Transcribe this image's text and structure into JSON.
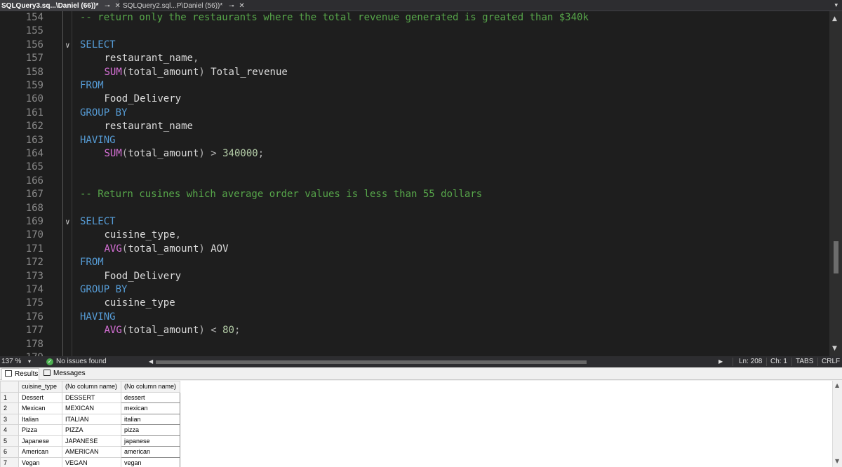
{
  "tabs": [
    {
      "label": "SQLQuery3.sq...\\Daniel (66))*",
      "pin": "⊸",
      "close": "✕",
      "active": true
    },
    {
      "label": "SQLQuery2.sql...P\\Daniel (56))*",
      "pin": "⊸",
      "close": "✕",
      "active": false
    }
  ],
  "tab_overflow_icon": "▾",
  "editor": {
    "lines": [
      {
        "n": "154",
        "fold": "",
        "indent": 0,
        "tokens": [
          [
            "cm",
            "-- return only the restaurants where the total revenue generated is greated than $340k"
          ]
        ]
      },
      {
        "n": "155",
        "fold": "",
        "indent": 0,
        "tokens": []
      },
      {
        "n": "156",
        "fold": "∨",
        "indent": 0,
        "tokens": [
          [
            "kw",
            "SELECT"
          ]
        ]
      },
      {
        "n": "157",
        "fold": "",
        "indent": 1,
        "tokens": [
          [
            "id",
            "restaurant_name"
          ],
          [
            "op",
            ","
          ]
        ]
      },
      {
        "n": "158",
        "fold": "",
        "indent": 1,
        "tokens": [
          [
            "fn",
            "SUM"
          ],
          [
            "op",
            "("
          ],
          [
            "id",
            "total_amount"
          ],
          [
            "op",
            ")"
          ],
          [
            "id",
            " Total_revenue"
          ]
        ]
      },
      {
        "n": "159",
        "fold": "",
        "indent": 0,
        "tokens": [
          [
            "kw",
            "FROM"
          ]
        ]
      },
      {
        "n": "160",
        "fold": "",
        "indent": 1,
        "tokens": [
          [
            "id",
            "Food_Delivery"
          ]
        ]
      },
      {
        "n": "161",
        "fold": "",
        "indent": 0,
        "tokens": [
          [
            "kw",
            "GROUP BY"
          ]
        ]
      },
      {
        "n": "162",
        "fold": "",
        "indent": 1,
        "tokens": [
          [
            "id",
            "restaurant_name"
          ]
        ]
      },
      {
        "n": "163",
        "fold": "",
        "indent": 0,
        "tokens": [
          [
            "kw",
            "HAVING"
          ]
        ]
      },
      {
        "n": "164",
        "fold": "",
        "indent": 1,
        "tokens": [
          [
            "fn",
            "SUM"
          ],
          [
            "op",
            "("
          ],
          [
            "id",
            "total_amount"
          ],
          [
            "op",
            ")"
          ],
          [
            "op",
            " > "
          ],
          [
            "num",
            "340000"
          ],
          [
            "op",
            ";"
          ]
        ]
      },
      {
        "n": "165",
        "fold": "",
        "indent": 0,
        "tokens": []
      },
      {
        "n": "166",
        "fold": "",
        "indent": 0,
        "tokens": []
      },
      {
        "n": "167",
        "fold": "",
        "indent": 0,
        "tokens": [
          [
            "cm",
            "-- Return cusines which average order values is less than 55 dollars"
          ]
        ]
      },
      {
        "n": "168",
        "fold": "",
        "indent": 0,
        "tokens": []
      },
      {
        "n": "169",
        "fold": "∨",
        "indent": 0,
        "tokens": [
          [
            "kw",
            "SELECT"
          ]
        ]
      },
      {
        "n": "170",
        "fold": "",
        "indent": 1,
        "tokens": [
          [
            "id",
            "cuisine_type"
          ],
          [
            "op",
            ","
          ]
        ]
      },
      {
        "n": "171",
        "fold": "",
        "indent": 1,
        "tokens": [
          [
            "fn",
            "AVG"
          ],
          [
            "op",
            "("
          ],
          [
            "id",
            "total_amount"
          ],
          [
            "op",
            ")"
          ],
          [
            "id",
            " AOV"
          ]
        ]
      },
      {
        "n": "172",
        "fold": "",
        "indent": 0,
        "tokens": [
          [
            "kw",
            "FROM"
          ]
        ]
      },
      {
        "n": "173",
        "fold": "",
        "indent": 1,
        "tokens": [
          [
            "id",
            "Food_Delivery"
          ]
        ]
      },
      {
        "n": "174",
        "fold": "",
        "indent": 0,
        "tokens": [
          [
            "kw",
            "GROUP BY"
          ]
        ]
      },
      {
        "n": "175",
        "fold": "",
        "indent": 1,
        "tokens": [
          [
            "id",
            "cuisine_type"
          ]
        ]
      },
      {
        "n": "176",
        "fold": "",
        "indent": 0,
        "tokens": [
          [
            "kw",
            "HAVING"
          ]
        ]
      },
      {
        "n": "177",
        "fold": "",
        "indent": 1,
        "tokens": [
          [
            "fn",
            "AVG"
          ],
          [
            "op",
            "("
          ],
          [
            "id",
            "total_amount"
          ],
          [
            "op",
            ")"
          ],
          [
            "op",
            " < "
          ],
          [
            "num",
            "80"
          ],
          [
            "op",
            ";"
          ]
        ]
      },
      {
        "n": "178",
        "fold": "",
        "indent": 0,
        "tokens": []
      },
      {
        "n": "179",
        "fold": "",
        "indent": 0,
        "tokens": []
      }
    ]
  },
  "status": {
    "zoom": "137 %",
    "zoom_dropdown": "▾",
    "issues_icon": "✓",
    "issues": "No issues found",
    "scroll_left": "◀",
    "scroll_right": "▶",
    "ln": "Ln: 208",
    "ch": "Ch: 1",
    "tabs": "TABS",
    "eol": "CRLF"
  },
  "results": {
    "tabs": [
      "Results",
      "Messages"
    ],
    "columns": [
      "cuisine_type",
      "(No column name)",
      "(No column name)"
    ],
    "rows": [
      {
        "n": "1",
        "cells": [
          "Dessert",
          "DESSERT",
          "dessert"
        ]
      },
      {
        "n": "2",
        "cells": [
          "Mexican",
          "MEXICAN",
          "mexican"
        ]
      },
      {
        "n": "3",
        "cells": [
          "Italian",
          "ITALIAN",
          "italian"
        ]
      },
      {
        "n": "4",
        "cells": [
          "Pizza",
          "PIZZA",
          "pizza"
        ]
      },
      {
        "n": "5",
        "cells": [
          "Japanese",
          "JAPANESE",
          "japanese"
        ]
      },
      {
        "n": "6",
        "cells": [
          "American",
          "AMERICAN",
          "american"
        ]
      },
      {
        "n": "7",
        "cells": [
          "Vegan",
          "VEGAN",
          "vegan"
        ]
      }
    ]
  },
  "colors": {
    "keyword": "#569cd6",
    "function": "#d670d6",
    "comment": "#57a64a",
    "number": "#b5cea8",
    "editor_bg": "#1e1e1e"
  }
}
